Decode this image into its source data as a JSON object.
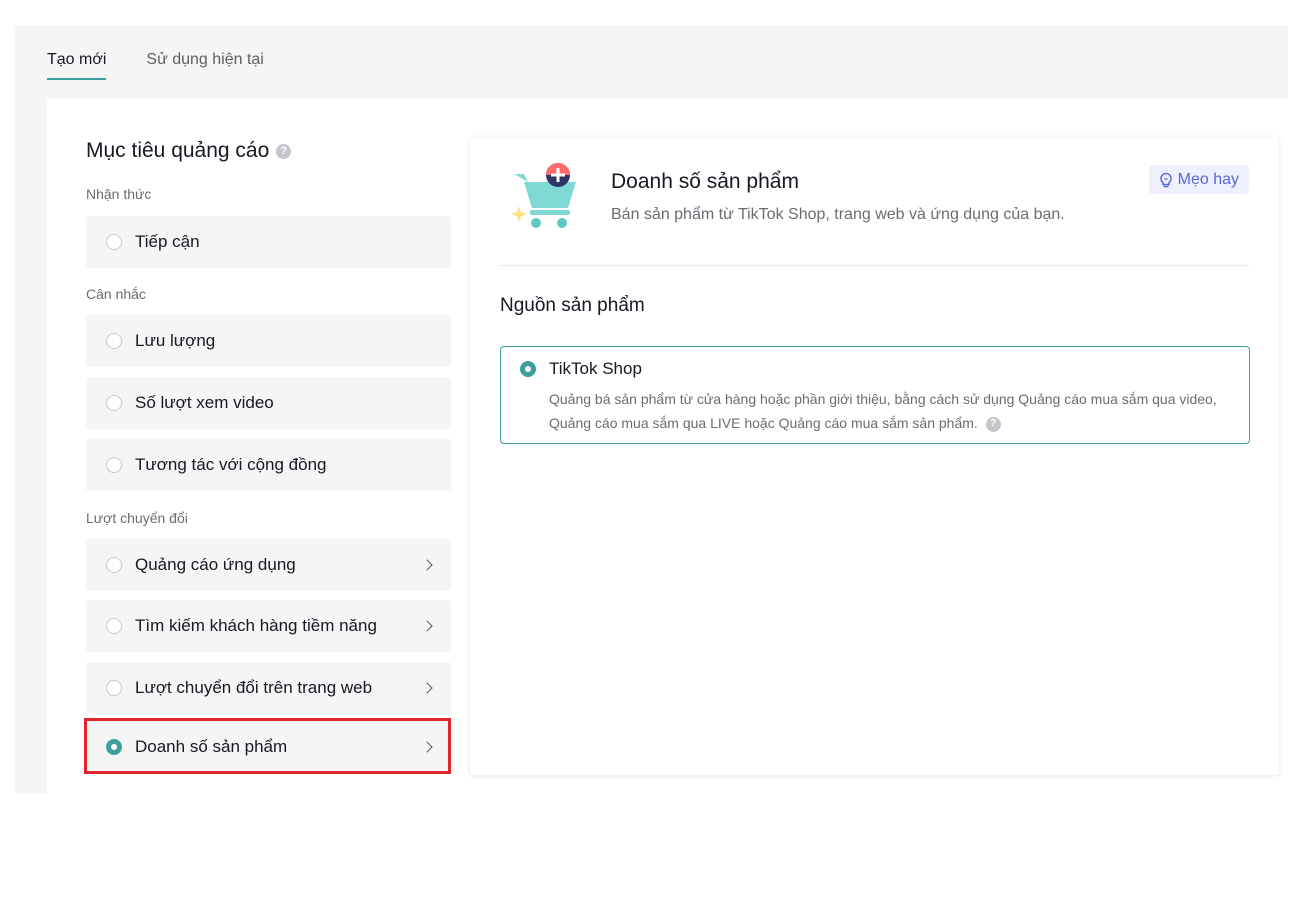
{
  "tabs": [
    {
      "label": "Tạo mới",
      "active": true
    },
    {
      "label": "Sử dụng hiện tại",
      "active": false
    }
  ],
  "objective": {
    "title": "Mục tiêu quảng cáo",
    "help_icon": "?",
    "groups": [
      {
        "label": "Nhận thức",
        "options": [
          {
            "label": "Tiếp cận"
          }
        ]
      },
      {
        "label": "Cân nhắc",
        "options": [
          {
            "label": "Lưu lượng"
          },
          {
            "label": "Số lượt xem video"
          },
          {
            "label": "Tương tác với cộng đồng"
          }
        ]
      },
      {
        "label": "Lượt chuyển đổi",
        "options": [
          {
            "label": "Quảng cáo ứng dụng"
          },
          {
            "label": "Tìm kiếm khách hàng tiềm năng"
          },
          {
            "label": "Lượt chuyển đổi trên trang web"
          },
          {
            "label": "Doanh số sản phẩm",
            "selected": true
          }
        ]
      }
    ]
  },
  "panel": {
    "title": "Doanh số sản phẩm",
    "subtitle": "Bán sản phẩm từ TikTok Shop, trang web và ứng dụng của bạn.",
    "tips_label": "Mẹo hay",
    "source_title": "Nguồn sản phẩm",
    "source": {
      "name": "TikTok Shop",
      "description": "Quảng bá sản phẩm từ cửa hàng hoặc phần giới thiệu, bằng cách sử dụng Quảng cáo mua sắm qua video, Quảng cáo mua sắm qua LIVE hoặc Quảng cáo mua sắm sản phẩm."
    }
  },
  "colors": {
    "accent": "#3d9e9a",
    "highlight": "#e1252a",
    "tips_text": "#5a66d6"
  }
}
